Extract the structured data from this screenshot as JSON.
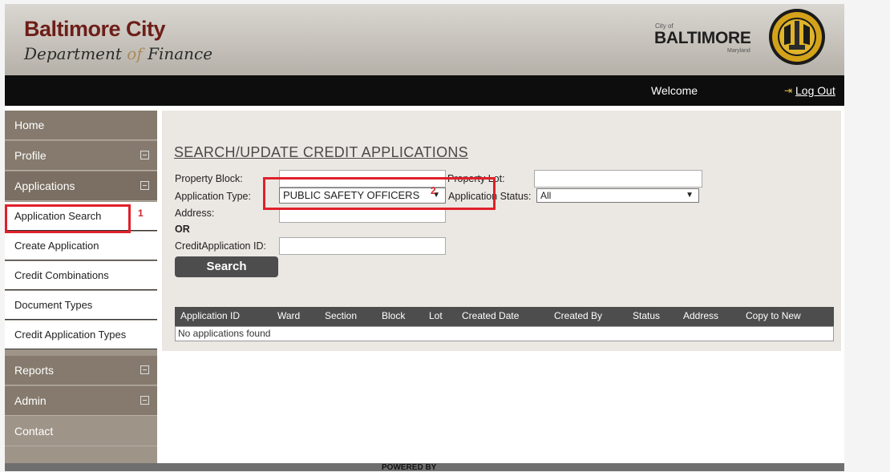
{
  "header": {
    "brand_name": "Baltimore City",
    "brand_dept_pre": "Department ",
    "brand_dept_of": "of",
    "brand_dept_post": " Finance",
    "city_small": "City of",
    "city_big": "BALTIMORE",
    "city_state": "Maryland",
    "seal_icon": "baltimore-city-seal-icon"
  },
  "topbar": {
    "welcome": "Welcome",
    "logout_label": "Log Out"
  },
  "sidebar": {
    "items": [
      {
        "label": "Home"
      },
      {
        "label": "Profile"
      },
      {
        "label": "Applications"
      },
      {
        "label": "Application Search"
      },
      {
        "label": "Create Application"
      },
      {
        "label": "Credit Combinations"
      },
      {
        "label": "Document Types"
      },
      {
        "label": "Credit Application Types"
      },
      {
        "label": "Reports"
      },
      {
        "label": "Admin"
      },
      {
        "label": "Contact"
      }
    ]
  },
  "main": {
    "title": "SEARCH/UPDATE CREDIT APPLICATIONS",
    "form": {
      "property_block_label": "Property Block:",
      "property_block_value": "",
      "property_lot_label": "Property Lot:",
      "property_lot_value": "",
      "application_type_label": "Application Type:",
      "application_type_value": "PUBLIC SAFETY OFFICERS",
      "application_status_label": "Application Status:",
      "application_status_value": "All",
      "address_label": "Address:",
      "address_value": "",
      "or_label": "OR",
      "credit_app_id_label": "CreditApplication ID:",
      "credit_app_id_value": "",
      "search_button": "Search"
    },
    "table": {
      "columns": [
        "Application ID",
        "Ward",
        "Section",
        "Block",
        "Lot",
        "Created Date",
        "Created By",
        "Status",
        "Address",
        "Copy to New"
      ],
      "empty_message": "No applications found"
    }
  },
  "annotations": {
    "marker_1": "1",
    "marker_2": "2"
  },
  "footer": {
    "text": "POWERED BY"
  },
  "colors": {
    "brand_red": "#6d1e18",
    "annotation_red": "#e0202a",
    "sidebar_bg": "#9e9488",
    "dark_bar": "#0d0d0d"
  }
}
